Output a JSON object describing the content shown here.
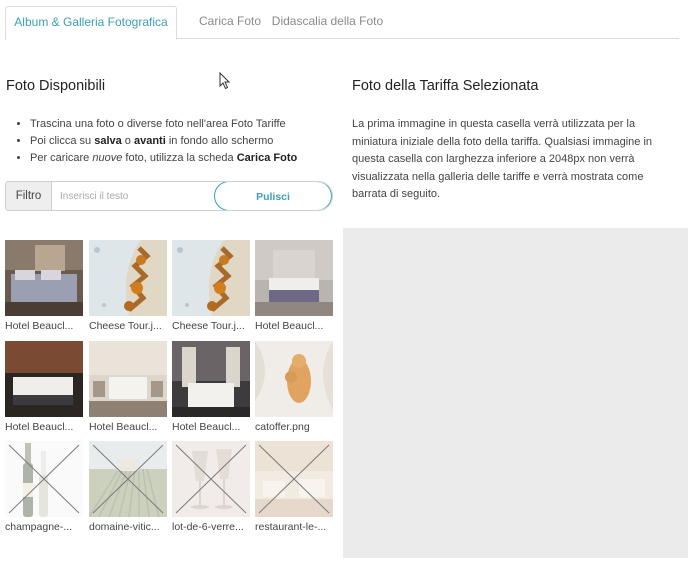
{
  "tabs": [
    {
      "label": "Album & Galleria Fotografica",
      "active": true
    },
    {
      "label": "Carica Foto",
      "active": false
    },
    {
      "label": "Didascalia della Foto",
      "active": false
    }
  ],
  "left": {
    "title": "Foto Disponibili",
    "instructions": {
      "line1": "Trascina una foto o diverse foto nell'area Foto Tariffe",
      "line2_pre": "Poi clicca su ",
      "line2_b1": "salva",
      "line2_mid": " o ",
      "line2_b2": "avanti",
      "line2_post": " in fondo allo schermo",
      "line3_pre": "Per caricare ",
      "line3_em": "nuove",
      "line3_mid": " foto, utilizza la scheda ",
      "line3_b": "Carica Foto"
    },
    "filter": {
      "label": "Filtro",
      "placeholder": "Inserisci il testo",
      "clear": "Pulisci"
    }
  },
  "right": {
    "title": "Foto della Tariffa Selezionata",
    "description": "La prima immagine in questa casella verrà utilizzata per la miniatura iniziale della foto della tariffa. Qualsiasi immagine in questa casella con larghezza inferiore a 2048px non verrà visualizzata nella galleria delle tariffe e verrà mostrata come barrata di seguito."
  },
  "photos": [
    {
      "caption": "Hotel Beaucl...",
      "kind": "bedroom-a",
      "struck": false
    },
    {
      "caption": "Cheese Tour.j...",
      "kind": "cheese",
      "struck": false
    },
    {
      "caption": "Cheese Tour.j...",
      "kind": "cheese",
      "struck": false
    },
    {
      "caption": "Hotel Beaucl...",
      "kind": "bedroom-b",
      "struck": false
    },
    {
      "caption": "Hotel Beaucl...",
      "kind": "bedroom-c",
      "struck": false
    },
    {
      "caption": "Hotel Beaucl...",
      "kind": "bedroom-d",
      "struck": false
    },
    {
      "caption": "Hotel Beaucl...",
      "kind": "bedroom-e",
      "struck": false
    },
    {
      "caption": "catoffer.png",
      "kind": "cat",
      "struck": false
    },
    {
      "caption": "champagne-...",
      "kind": "champagne",
      "struck": true
    },
    {
      "caption": "domaine-vitic...",
      "kind": "vineyard",
      "struck": true
    },
    {
      "caption": "lot-de-6-verre...",
      "kind": "glasses",
      "struck": true
    },
    {
      "caption": "restaurant-le-...",
      "kind": "restaurant",
      "struck": true
    }
  ],
  "colors": {
    "accent": "#3aa0b6",
    "drop_zone": "#ebebeb"
  }
}
